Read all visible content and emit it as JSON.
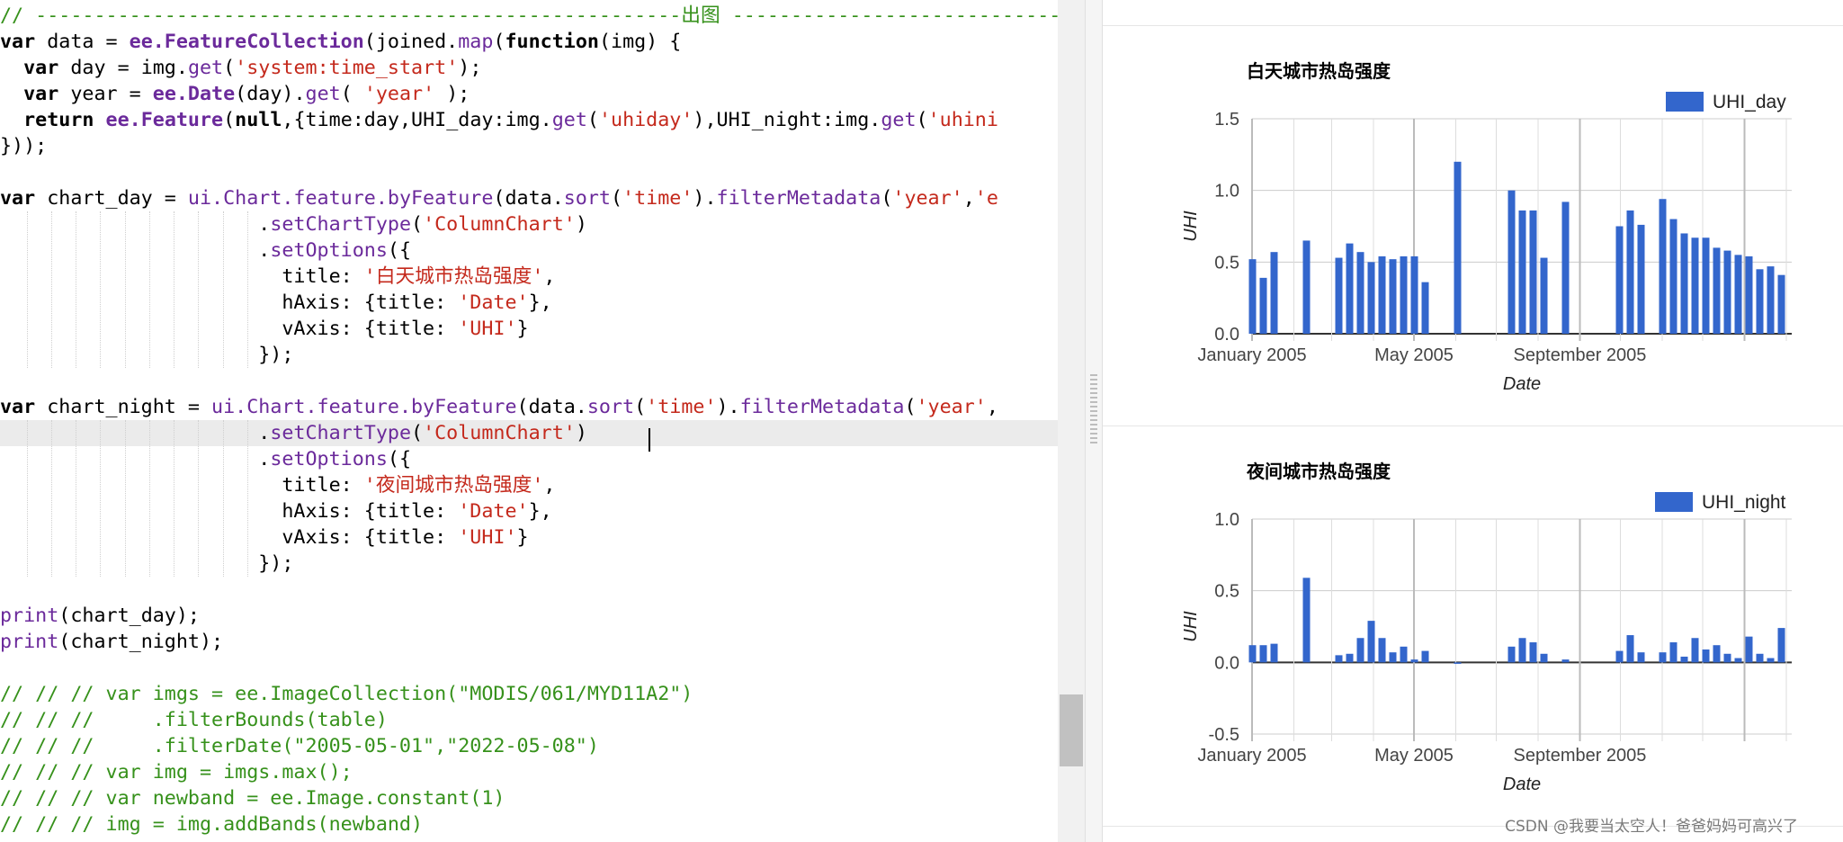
{
  "editor": {
    "lines": [
      {
        "tokens": [
          [
            "cmt",
            "// -------------------------------------------------------出图 ---------------------------------"
          ]
        ]
      },
      {
        "tokens": [
          [
            "kw",
            "var"
          ],
          [
            "plain",
            " data = "
          ],
          [
            "ee",
            "ee.FeatureCollection"
          ],
          [
            "plain",
            "(joined."
          ],
          [
            "fn",
            "map"
          ],
          [
            "plain",
            "("
          ],
          [
            "kw",
            "function"
          ],
          [
            "plain",
            "(img) {"
          ]
        ]
      },
      {
        "tokens": [
          [
            "plain",
            "  "
          ],
          [
            "kw",
            "var"
          ],
          [
            "plain",
            " day = img."
          ],
          [
            "fn",
            "get"
          ],
          [
            "plain",
            "("
          ],
          [
            "str",
            "'system:time_start'"
          ],
          [
            "plain",
            ");"
          ]
        ]
      },
      {
        "tokens": [
          [
            "plain",
            "  "
          ],
          [
            "kw",
            "var"
          ],
          [
            "plain",
            " year = "
          ],
          [
            "ee",
            "ee.Date"
          ],
          [
            "plain",
            "(day)."
          ],
          [
            "fn",
            "get"
          ],
          [
            "plain",
            "( "
          ],
          [
            "str",
            "'year'"
          ],
          [
            "plain",
            " );"
          ]
        ]
      },
      {
        "tokens": [
          [
            "plain",
            "  "
          ],
          [
            "kw",
            "return"
          ],
          [
            "plain",
            " "
          ],
          [
            "ee",
            "ee.Feature"
          ],
          [
            "plain",
            "("
          ],
          [
            "kw",
            "null"
          ],
          [
            "plain",
            ",{time:day,UHI_day:img."
          ],
          [
            "fn",
            "get"
          ],
          [
            "plain",
            "("
          ],
          [
            "str",
            "'uhiday'"
          ],
          [
            "plain",
            "),UHI_night:img."
          ],
          [
            "fn",
            "get"
          ],
          [
            "plain",
            "("
          ],
          [
            "str",
            "'uhini"
          ]
        ]
      },
      {
        "tokens": [
          [
            "plain",
            "}));"
          ]
        ]
      },
      {
        "tokens": []
      },
      {
        "tokens": [
          [
            "kw",
            "var"
          ],
          [
            "plain",
            " chart_day = "
          ],
          [
            "fn",
            "ui.Chart.feature.byFeature"
          ],
          [
            "plain",
            "(data."
          ],
          [
            "fn",
            "sort"
          ],
          [
            "plain",
            "("
          ],
          [
            "str",
            "'time'"
          ],
          [
            "plain",
            ")."
          ],
          [
            "fn",
            "filterMetadata"
          ],
          [
            "plain",
            "("
          ],
          [
            "str",
            "'year'"
          ],
          [
            "plain",
            ","
          ],
          [
            "str",
            "'e"
          ]
        ]
      },
      {
        "tokens": [
          [
            "plain",
            "                      ."
          ],
          [
            "fn",
            "setChartType"
          ],
          [
            "plain",
            "("
          ],
          [
            "str",
            "'ColumnChart'"
          ],
          [
            "plain",
            ")"
          ]
        ]
      },
      {
        "tokens": [
          [
            "plain",
            "                      ."
          ],
          [
            "fn",
            "setOptions"
          ],
          [
            "plain",
            "({"
          ]
        ]
      },
      {
        "tokens": [
          [
            "plain",
            "                        title: "
          ],
          [
            "str",
            "'白天城市热岛强度'"
          ],
          [
            "plain",
            ","
          ]
        ]
      },
      {
        "tokens": [
          [
            "plain",
            "                        hAxis: {title: "
          ],
          [
            "str",
            "'Date'"
          ],
          [
            "plain",
            "},"
          ]
        ]
      },
      {
        "tokens": [
          [
            "plain",
            "                        vAxis: {title: "
          ],
          [
            "str",
            "'UHI'"
          ],
          [
            "plain",
            "}"
          ]
        ]
      },
      {
        "tokens": [
          [
            "plain",
            "                      });"
          ]
        ]
      },
      {
        "tokens": []
      },
      {
        "tokens": [
          [
            "kw",
            "var"
          ],
          [
            "plain",
            " chart_night = "
          ],
          [
            "fn",
            "ui.Chart.feature.byFeature"
          ],
          [
            "plain",
            "(data."
          ],
          [
            "fn",
            "sort"
          ],
          [
            "plain",
            "("
          ],
          [
            "str",
            "'time'"
          ],
          [
            "plain",
            ")."
          ],
          [
            "fn",
            "filterMetadata"
          ],
          [
            "plain",
            "("
          ],
          [
            "str",
            "'year'"
          ],
          [
            "plain",
            ","
          ]
        ]
      },
      {
        "tokens": [
          [
            "plain",
            "                      ."
          ],
          [
            "fn",
            "setChartType"
          ],
          [
            "plain",
            "("
          ],
          [
            "str",
            "'ColumnChart'"
          ],
          [
            "plain",
            ")"
          ]
        ]
      },
      {
        "tokens": [
          [
            "plain",
            "                      ."
          ],
          [
            "fn",
            "setOptions"
          ],
          [
            "plain",
            "({"
          ]
        ]
      },
      {
        "tokens": [
          [
            "plain",
            "                        title: "
          ],
          [
            "str",
            "'夜间城市热岛强度'"
          ],
          [
            "plain",
            ","
          ]
        ]
      },
      {
        "tokens": [
          [
            "plain",
            "                        hAxis: {title: "
          ],
          [
            "str",
            "'Date'"
          ],
          [
            "plain",
            "},"
          ]
        ]
      },
      {
        "tokens": [
          [
            "plain",
            "                        vAxis: {title: "
          ],
          [
            "str",
            "'UHI'"
          ],
          [
            "plain",
            "}"
          ]
        ]
      },
      {
        "tokens": [
          [
            "plain",
            "                      });"
          ]
        ]
      },
      {
        "tokens": []
      },
      {
        "tokens": [
          [
            "fn",
            "print"
          ],
          [
            "plain",
            "(chart_day);"
          ]
        ]
      },
      {
        "tokens": [
          [
            "fn",
            "print"
          ],
          [
            "plain",
            "(chart_night);"
          ]
        ]
      },
      {
        "tokens": []
      },
      {
        "tokens": [
          [
            "cmt",
            "// // // var imgs = ee.ImageCollection(\"MODIS/061/MYD11A2\")"
          ]
        ]
      },
      {
        "tokens": [
          [
            "cmt",
            "// // //     .filterBounds(table)"
          ]
        ]
      },
      {
        "tokens": [
          [
            "cmt",
            "// // //     .filterDate(\"2005-05-01\",\"2022-05-08\")"
          ]
        ]
      },
      {
        "tokens": [
          [
            "cmt",
            "// // // var img = imgs.max();"
          ]
        ]
      },
      {
        "tokens": [
          [
            "cmt",
            "// // // var newband = ee.Image.constant(1)"
          ]
        ]
      },
      {
        "tokens": [
          [
            "cmt",
            "// // // img = img.addBands(newband)"
          ]
        ]
      }
    ]
  },
  "colors": {
    "bar": "#3366cc",
    "grid": "#cccccc",
    "axis_text": "#444444",
    "comment": "#36911b",
    "string": "#c4291c",
    "function": "#6b2a9b"
  },
  "watermark": "CSDN @我要当太空人！爸爸妈妈可高兴了",
  "chart_data": [
    {
      "type": "bar",
      "title": "白天城市热岛强度",
      "xlabel": "Date",
      "ylabel": "UHI",
      "ylim": [
        0,
        1.5
      ],
      "yticks": [
        "0.0",
        "0.5",
        "1.0",
        "1.5"
      ],
      "xticks": [
        "January 2005",
        "May 2005",
        "September 2005"
      ],
      "legend_position": "top-right",
      "grid": true,
      "series": [
        {
          "name": "UHI_day",
          "values": [
            0.52,
            0.39,
            0.57,
            0.65,
            0.53,
            0.63,
            0.57,
            0.5,
            0.54,
            0.52,
            0.54,
            0.54,
            0.36,
            1.2,
            1.0,
            0.86,
            0.86,
            0.53,
            0.92,
            0.75,
            0.86,
            0.76,
            0.94,
            0.8,
            0.7,
            0.67,
            0.67,
            0.6,
            0.58,
            0.55,
            0.54,
            0.45,
            0.47,
            0.41
          ],
          "dates": [
            "2005-01-01",
            "2005-01-09",
            "2005-01-17",
            "2005-02-10",
            "2005-03-06",
            "2005-03-14",
            "2005-03-22",
            "2005-03-30",
            "2005-04-07",
            "2005-04-15",
            "2005-04-23",
            "2005-05-01",
            "2005-05-09",
            "2005-06-02",
            "2005-07-12",
            "2005-07-20",
            "2005-07-28",
            "2005-08-05",
            "2005-08-21",
            "2005-09-30",
            "2005-10-08",
            "2005-10-16",
            "2005-11-01",
            "2005-11-09",
            "2005-11-17",
            "2005-11-25",
            "2005-12-03",
            "2005-12-11",
            "2005-12-19",
            "2005-12-27",
            "2006-01-04",
            "2006-01-12",
            "2006-01-20",
            "2006-01-28"
          ]
        }
      ]
    },
    {
      "type": "bar",
      "title": "夜间城市热岛强度",
      "xlabel": "Date",
      "ylabel": "UHI",
      "ylim": [
        -0.5,
        1.0
      ],
      "yticks": [
        "-0.5",
        "0.0",
        "0.5",
        "1.0"
      ],
      "xticks": [
        "January 2005",
        "May 2005",
        "September 2005"
      ],
      "legend_position": "top-right",
      "grid": true,
      "series": [
        {
          "name": "UHI_night",
          "values": [
            0.12,
            0.12,
            0.13,
            0.59,
            0.05,
            0.06,
            0.17,
            0.29,
            0.17,
            0.07,
            0.11,
            0.02,
            0.08,
            -0.01,
            0.11,
            0.17,
            0.14,
            0.06,
            0.02,
            0.08,
            0.19,
            0.07,
            0.07,
            0.14,
            0.04,
            0.17,
            0.09,
            0.12,
            0.06,
            0.03,
            0.18,
            0.06,
            0.03,
            0.24
          ],
          "dates": [
            "2005-01-01",
            "2005-01-09",
            "2005-01-17",
            "2005-02-10",
            "2005-03-06",
            "2005-03-14",
            "2005-03-22",
            "2005-03-30",
            "2005-04-07",
            "2005-04-15",
            "2005-04-23",
            "2005-05-01",
            "2005-05-09",
            "2005-06-02",
            "2005-07-12",
            "2005-07-20",
            "2005-07-28",
            "2005-08-05",
            "2005-08-21",
            "2005-09-30",
            "2005-10-08",
            "2005-10-16",
            "2005-11-01",
            "2005-11-09",
            "2005-11-17",
            "2005-11-25",
            "2005-12-03",
            "2005-12-11",
            "2005-12-19",
            "2005-12-27",
            "2006-01-04",
            "2006-01-12",
            "2006-01-20",
            "2006-01-28"
          ]
        }
      ]
    }
  ]
}
